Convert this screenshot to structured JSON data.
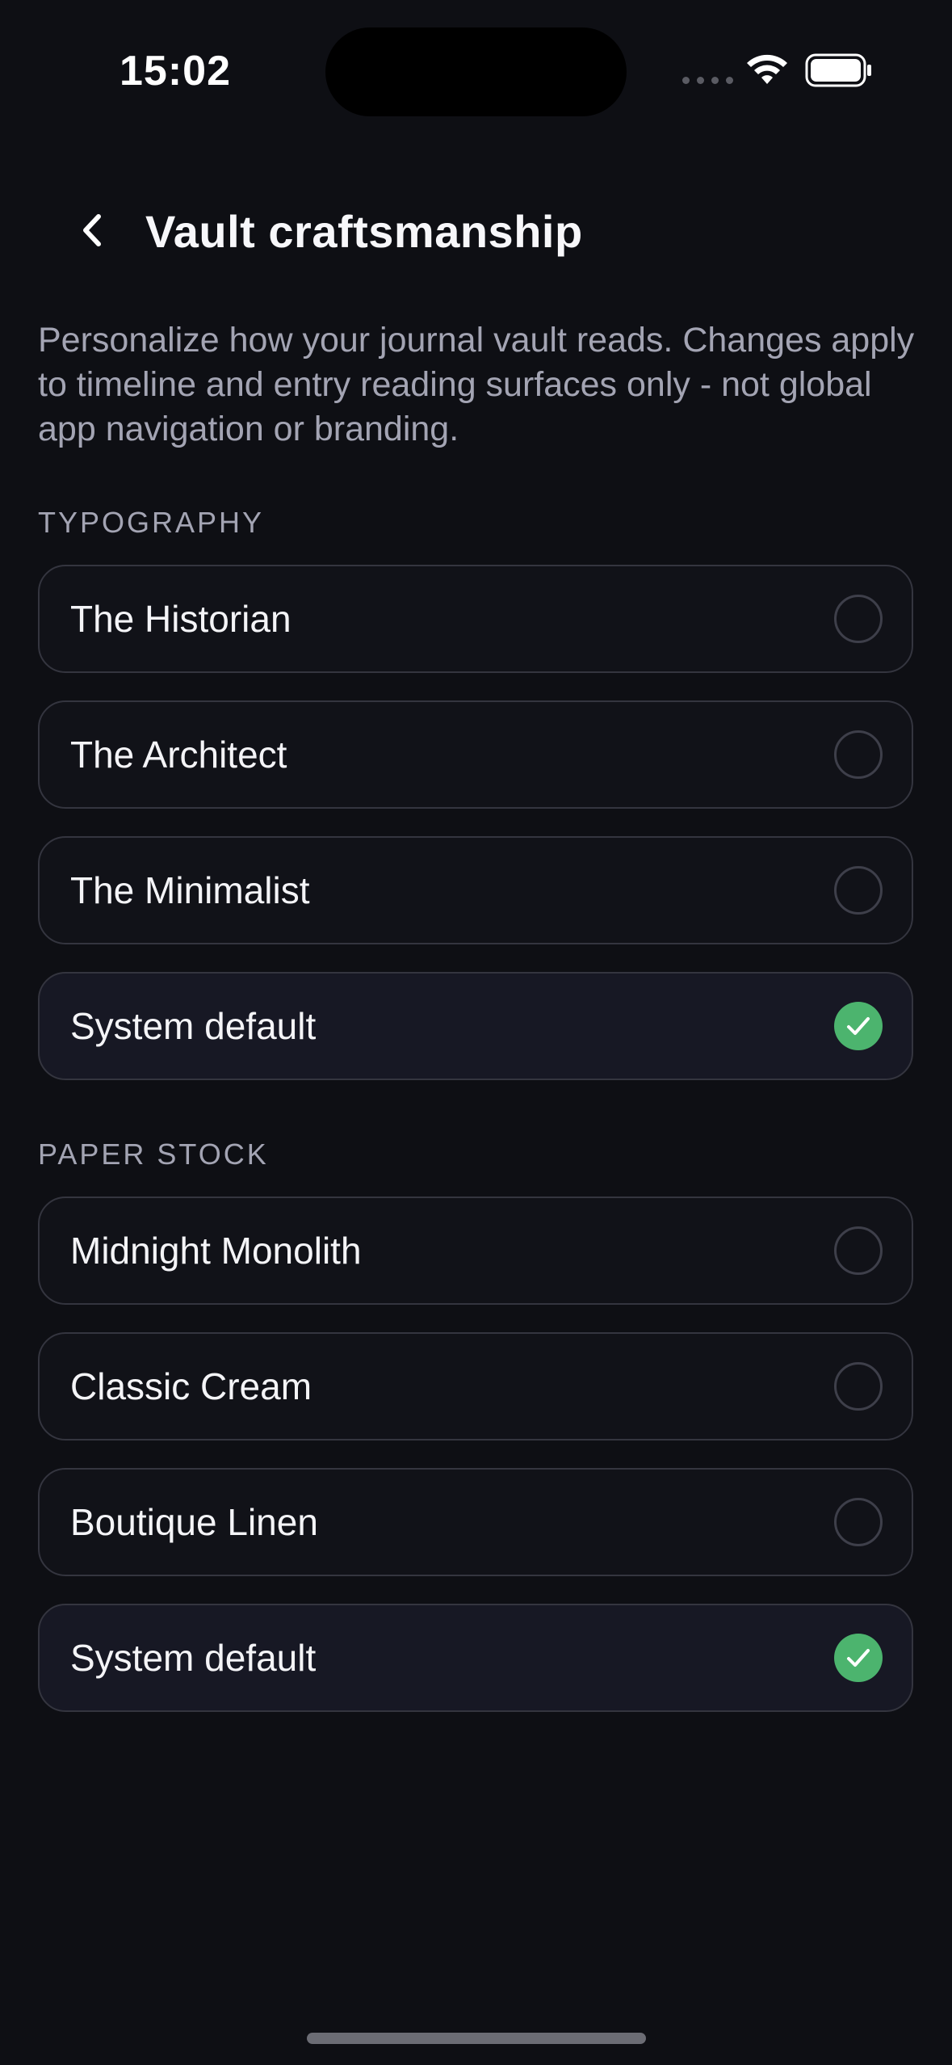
{
  "status_bar": {
    "time": "15:02"
  },
  "header": {
    "title": "Vault craftsmanship",
    "back_icon": "chevron-left-icon"
  },
  "description": "Personalize how your journal vault reads. Changes apply to timeline and entry reading surfaces only - not global app navigation or branding.",
  "typography": {
    "label": "TYPOGRAPHY",
    "options": [
      {
        "label": "The Historian",
        "selected": false
      },
      {
        "label": "The Architect",
        "selected": false
      },
      {
        "label": "The Minimalist",
        "selected": false
      },
      {
        "label": "System default",
        "selected": true
      }
    ]
  },
  "paper_stock": {
    "label": "PAPER STOCK",
    "options": [
      {
        "label": "Midnight Monolith",
        "selected": false
      },
      {
        "label": "Classic Cream",
        "selected": false
      },
      {
        "label": "Boutique Linen",
        "selected": false
      },
      {
        "label": "System default",
        "selected": true
      }
    ]
  },
  "colors": {
    "background": "#0e0f14",
    "accent_check": "#4cb46e",
    "border": "#34353f",
    "muted_text": "#a3a4b3"
  }
}
